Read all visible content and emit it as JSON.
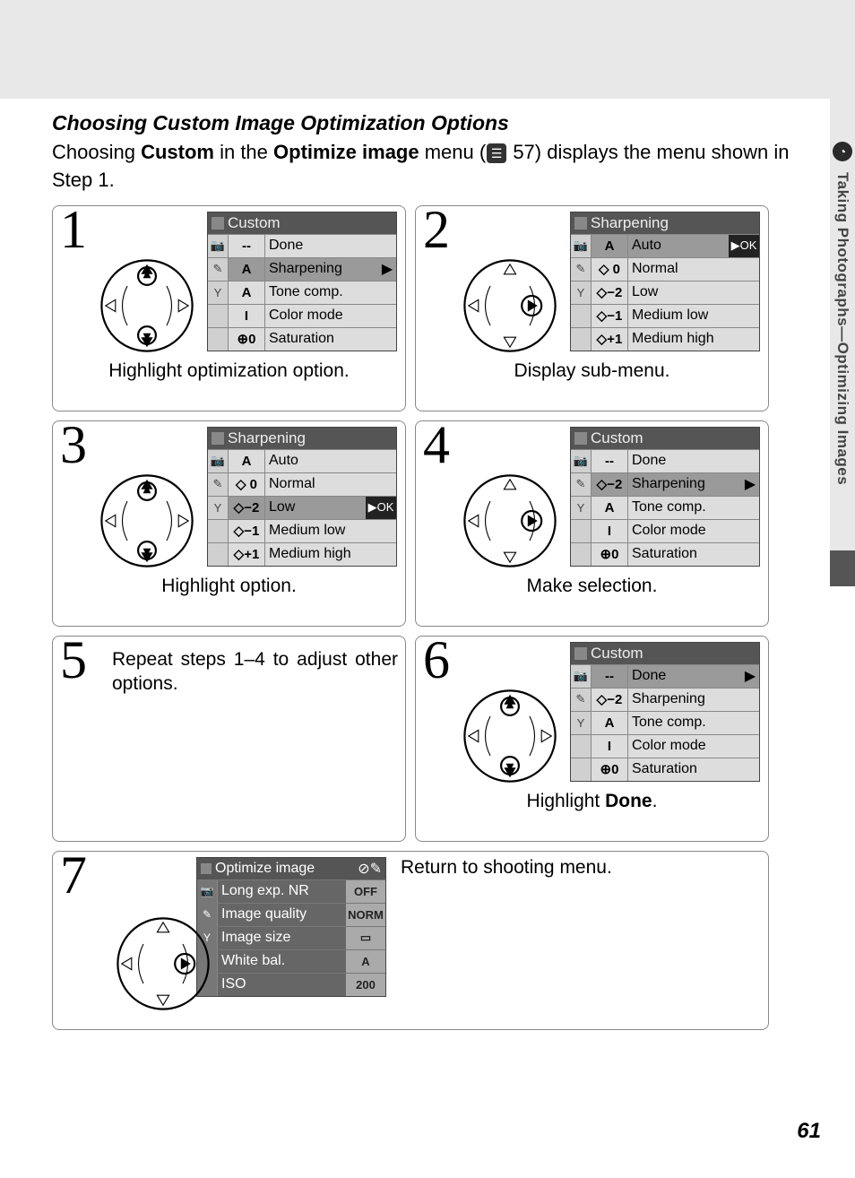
{
  "sidetab": {
    "label": "Taking Photographs—Optimizing Images"
  },
  "title": "Choosing Custom Image Optimization Options",
  "intro_a": "Choosing ",
  "intro_b": "Custom",
  "intro_c": " in the ",
  "intro_d": "Optimize image",
  "intro_e": " menu (",
  "intro_f": " 57) displays the menu shown in Step 1.",
  "pageref_icon": "☰",
  "steps": {
    "s1": {
      "num": "1",
      "menu_title": "Custom",
      "rows": [
        {
          "icon": "📷",
          "val": "--",
          "label": "Done",
          "hl": false,
          "arr": ""
        },
        {
          "icon": "✎",
          "val": "A",
          "label": "Sharpening",
          "hl": true,
          "arr": "▶"
        },
        {
          "icon": "Y",
          "val": "A",
          "label": "Tone comp.",
          "hl": false,
          "arr": ""
        },
        {
          "icon": "",
          "val": "I",
          "label": "Color mode",
          "hl": false,
          "arr": ""
        },
        {
          "icon": "",
          "val": "⊕0",
          "label": "Saturation",
          "hl": false,
          "arr": ""
        }
      ],
      "caption": "Highlight optimization option."
    },
    "s2": {
      "num": "2",
      "menu_title": "Sharpening",
      "rows": [
        {
          "icon": "📷",
          "val": "A",
          "label": "Auto",
          "hl": true,
          "ok": "▶OK"
        },
        {
          "icon": "✎",
          "val": "◇ 0",
          "label": "Normal",
          "hl": false
        },
        {
          "icon": "Y",
          "val": "◇−2",
          "label": "Low",
          "hl": false
        },
        {
          "icon": "",
          "val": "◇−1",
          "label": "Medium low",
          "hl": false
        },
        {
          "icon": "",
          "val": "◇+1",
          "label": "Medium high",
          "hl": false
        }
      ],
      "caption": "Display sub-menu."
    },
    "s3": {
      "num": "3",
      "menu_title": "Sharpening",
      "rows": [
        {
          "icon": "📷",
          "val": "A",
          "label": "Auto",
          "hl": false
        },
        {
          "icon": "✎",
          "val": "◇ 0",
          "label": "Normal",
          "hl": false
        },
        {
          "icon": "Y",
          "val": "◇−2",
          "label": "Low",
          "hl": true,
          "ok": "▶OK"
        },
        {
          "icon": "",
          "val": "◇−1",
          "label": "Medium low",
          "hl": false
        },
        {
          "icon": "",
          "val": "◇+1",
          "label": "Medium high",
          "hl": false
        }
      ],
      "caption": "Highlight option."
    },
    "s4": {
      "num": "4",
      "menu_title": "Custom",
      "rows": [
        {
          "icon": "📷",
          "val": "--",
          "label": "Done",
          "hl": false,
          "arr": ""
        },
        {
          "icon": "✎",
          "val": "◇−2",
          "label": "Sharpening",
          "hl": true,
          "arr": "▶"
        },
        {
          "icon": "Y",
          "val": "A",
          "label": "Tone comp.",
          "hl": false,
          "arr": ""
        },
        {
          "icon": "",
          "val": "I",
          "label": "Color mode",
          "hl": false,
          "arr": ""
        },
        {
          "icon": "",
          "val": "⊕0",
          "label": "Saturation",
          "hl": false,
          "arr": ""
        }
      ],
      "caption": "Make selection."
    },
    "s5": {
      "num": "5",
      "text": "Repeat steps 1–4 to adjust other options."
    },
    "s6": {
      "num": "6",
      "menu_title": "Custom",
      "rows": [
        {
          "icon": "📷",
          "val": "--",
          "label": "Done",
          "hl": true,
          "arr": "▶"
        },
        {
          "icon": "✎",
          "val": "◇−2",
          "label": "Sharpening",
          "hl": false,
          "arr": ""
        },
        {
          "icon": "Y",
          "val": "A",
          "label": "Tone comp.",
          "hl": false,
          "arr": ""
        },
        {
          "icon": "",
          "val": "I",
          "label": "Color mode",
          "hl": false,
          "arr": ""
        },
        {
          "icon": "",
          "val": "⊕0",
          "label": "Saturation",
          "hl": false,
          "arr": ""
        }
      ],
      "caption_a": "Highlight ",
      "caption_b": "Done",
      "caption_c": "."
    },
    "s7": {
      "num": "7",
      "menu_title": "Optimize image",
      "menu_title_icon": "⊘✎",
      "rows": [
        {
          "icon": "📷",
          "label": "Long exp. NR",
          "val": "OFF"
        },
        {
          "icon": "✎",
          "label": "Image quality",
          "val": "NORM"
        },
        {
          "icon": "Y",
          "label": "Image size",
          "val": "▭"
        },
        {
          "icon": "",
          "label": "White bal.",
          "val": "A"
        },
        {
          "icon": "",
          "label": "ISO",
          "val": "200"
        }
      ],
      "caption": "Return to shooting menu."
    }
  },
  "pagenum": "61"
}
